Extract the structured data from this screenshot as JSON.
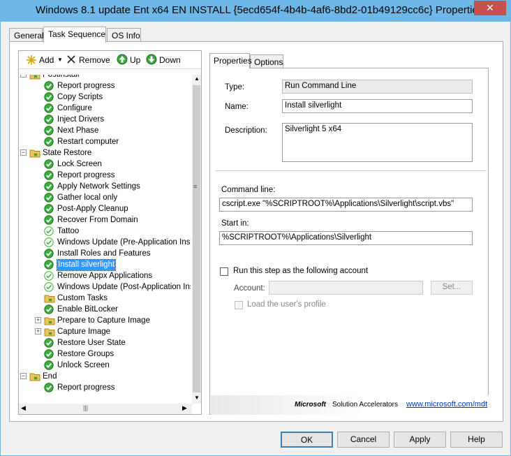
{
  "window": {
    "title": "Windows 8.1 update Ent x64 EN INSTALL {5ecd654f-4b4b-4af6-8bd2-01b49129cc6c} Properties",
    "close_glyph": "✕"
  },
  "main_tabs": [
    {
      "label": "General"
    },
    {
      "label": "Task Sequence"
    },
    {
      "label": "OS Info"
    }
  ],
  "toolbar": {
    "add_label": "Add",
    "remove_label": "Remove",
    "up_label": "Up",
    "down_label": "Down"
  },
  "tree": [
    {
      "label": "Postinstall",
      "type": "folder",
      "level": 0,
      "expander": "−"
    },
    {
      "label": "Report progress",
      "type": "step",
      "level": 1
    },
    {
      "label": "Copy Scripts",
      "type": "step",
      "level": 1
    },
    {
      "label": "Configure",
      "type": "step",
      "level": 1
    },
    {
      "label": "Inject Drivers",
      "type": "step",
      "level": 1
    },
    {
      "label": "Next Phase",
      "type": "step",
      "level": 1
    },
    {
      "label": "Restart computer",
      "type": "step",
      "level": 1
    },
    {
      "label": "State Restore",
      "type": "folder",
      "level": 0,
      "expander": "−"
    },
    {
      "label": "Lock Screen",
      "type": "step",
      "level": 1
    },
    {
      "label": "Report progress",
      "type": "step",
      "level": 1
    },
    {
      "label": "Apply Network Settings",
      "type": "step",
      "level": 1
    },
    {
      "label": "Gather local only",
      "type": "step",
      "level": 1
    },
    {
      "label": "Post-Apply Cleanup",
      "type": "step",
      "level": 1
    },
    {
      "label": "Recover From Domain",
      "type": "step",
      "level": 1
    },
    {
      "label": "Tattoo",
      "type": "step-disabled",
      "level": 1
    },
    {
      "label": "Windows Update (Pre-Application Inst",
      "type": "step-disabled",
      "level": 1
    },
    {
      "label": "Install Roles and Features",
      "type": "step",
      "level": 1
    },
    {
      "label": "Install silverlight",
      "type": "step",
      "level": 1,
      "selected": true
    },
    {
      "label": "Remove Appx Applications",
      "type": "step-disabled",
      "level": 1
    },
    {
      "label": "Windows Update (Post-Application Ins",
      "type": "step-disabled",
      "level": 1
    },
    {
      "label": "Custom Tasks",
      "type": "folder",
      "level": 1
    },
    {
      "label": "Enable BitLocker",
      "type": "step",
      "level": 1
    },
    {
      "label": "Prepare to Capture Image",
      "type": "folder",
      "level": 1,
      "expander": "+"
    },
    {
      "label": "Capture Image",
      "type": "folder",
      "level": 1,
      "expander": "+"
    },
    {
      "label": "Restore User State",
      "type": "step",
      "level": 1
    },
    {
      "label": "Restore Groups",
      "type": "step",
      "level": 1
    },
    {
      "label": "Unlock Screen",
      "type": "step",
      "level": 1
    },
    {
      "label": "End",
      "type": "folder",
      "level": 0,
      "expander": "−"
    },
    {
      "label": "Report progress",
      "type": "step",
      "level": 1
    }
  ],
  "props_tabs": [
    {
      "label": "Properties"
    },
    {
      "label": "Options"
    }
  ],
  "properties": {
    "type_label": "Type:",
    "type_value": "Run Command Line",
    "name_label": "Name:",
    "name_value": "Install silverlight",
    "description_label": "Description:",
    "description_value": "Silverlight 5 x64",
    "command_line_label": "Command line:",
    "command_line_value": "cscript.exe \"%SCRIPTROOT%\\Applications\\Silverlight\\script.vbs\"",
    "start_in_label": "Start in:",
    "start_in_value": "%SCRIPTROOT%\\Applications\\Silverlight",
    "run_as_label": "Run this step as the following account",
    "account_label": "Account:",
    "account_value": "",
    "set_button": "Set...",
    "load_profile_label": "Load the user's profile"
  },
  "branding": {
    "microsoft": "Microsoft",
    "solution_accelerators": "Solution Accelerators",
    "link": "www.microsoft.com/mdt"
  },
  "buttons": {
    "ok": "OK",
    "cancel": "Cancel",
    "apply": "Apply",
    "help": "Help"
  }
}
